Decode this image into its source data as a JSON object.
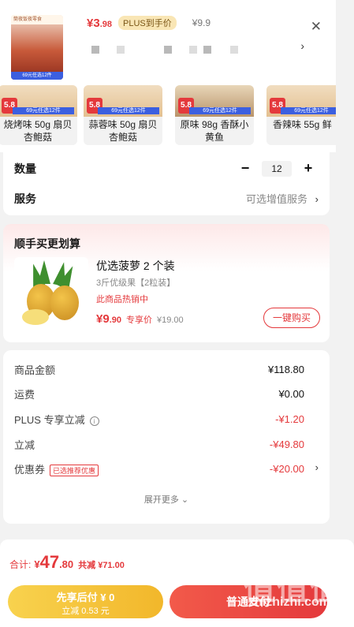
{
  "product": {
    "thumb_tag": "筒夜饭夜零食",
    "thumb_badge": "5.8",
    "thumb_promo": "69元任选12件",
    "price": "¥3",
    "price_decimal": ".98",
    "plus_label": "PLUS到手价",
    "original_price": "¥9.9"
  },
  "variants": [
    {
      "label": "烧烤味 50g 扇贝\n杏鲍菇",
      "badge": "5.8",
      "promo": "69元任选12件"
    },
    {
      "label": "蒜蓉味 50g 扇贝\n杏鲍菇",
      "badge": "5.8",
      "promo": "69元任选12件"
    },
    {
      "label": "原味 98g 香酥小\n黄鱼",
      "badge": "5.8",
      "promo": "69元任选12件"
    },
    {
      "label": "香辣味 55g 鲜",
      "badge": "5.8",
      "promo": "69元任选12件"
    }
  ],
  "quantity": {
    "label": "数量",
    "minus": "−",
    "value": "12",
    "plus": "+"
  },
  "service": {
    "label": "服务",
    "value": "可选增值服务",
    "arrow": "›"
  },
  "bundle": {
    "title": "顺手买更划算",
    "name": "优选菠萝 2 个装",
    "sub": "3斤优级果【2粒装】",
    "hot": "此商品热销中",
    "price": "¥9",
    "price_decimal": ".90",
    "price_tag": "专享价",
    "original": "¥19.00",
    "buy_label": "一键购买"
  },
  "totals": {
    "rows": [
      {
        "label": "商品金额",
        "value": "¥118.80"
      },
      {
        "label": "运费",
        "value": "¥0.00"
      },
      {
        "label": "PLUS 专享立减",
        "value": "-¥1.20"
      },
      {
        "label": "立减",
        "value": "-¥49.80"
      },
      {
        "label": "优惠券",
        "value": "-¥20.00"
      }
    ],
    "coupon_tag": "已选推荐优惠",
    "more": "展开更多"
  },
  "checkout": {
    "sum_label": "合计:",
    "sum_prefix": "¥",
    "sum_int": "47",
    "sum_dec": ".80",
    "saved": "共减 ¥71.00",
    "later_line1": "先享后付 ¥ 0",
    "later_line2": "立减 0.53 元",
    "pay": "普通支付"
  },
  "watermark": {
    "logo": "值值值",
    "text": "zhizhizhi.com"
  },
  "colors": {
    "accent": "#e4393c",
    "plus_badge": "#f9e6b5",
    "later_btn": "#f2b72b"
  }
}
